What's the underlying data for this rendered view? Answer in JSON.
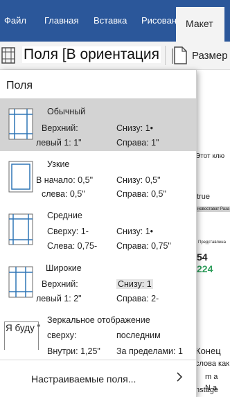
{
  "ribbon": {
    "tabs": [
      {
        "label": "Файл"
      },
      {
        "label": "Главная"
      },
      {
        "label": "Вставка"
      },
      {
        "label": "Рисование"
      },
      {
        "label": "Макет",
        "active": true
      }
    ]
  },
  "toolbar": {
    "margins_title": "Поля [В ориентация",
    "size_label": "Размер"
  },
  "margins_menu": {
    "header": "Поля",
    "options": [
      {
        "title": "Обычный",
        "l1": "Верхний:",
        "r1": "Снизу: 1•",
        "l2": "левый 1: 1\"",
        "r2": "Справа: 1\"",
        "selected": true
      },
      {
        "title": "Узкие",
        "l1": "В начало: 0,5\"",
        "r1": "Снизу: 0,5\"",
        "l2": "слева: 0,5\"",
        "r2": "Справа: 0,5\""
      },
      {
        "title": "Средние",
        "l1": "Сверху: 1-",
        "r1": "Снизу: 1•",
        "l2": "Слева: 0,75-",
        "r2": "Справа: 0,75\""
      },
      {
        "title": "Широкие",
        "l1": "Верхний:",
        "r1": "Снизу: 1",
        "l2": "левый 1: 2\"",
        "r2": "Справа: 2-"
      },
      {
        "title": "Зеркальное отображение",
        "icon_text": "Я буду \"",
        "l1": "сверху:",
        "r1": "последним",
        "l2": "Внутри: 1,25\"",
        "r2": "За пределами: 1"
      }
    ],
    "custom_label": "Настраиваемые поля...",
    "colors": {
      "selected_bg": "#d3d3d3",
      "ribbon": "#2b579a",
      "icon_blue": "#2e75b6"
    }
  },
  "document": {
    "lines": [
      "Этот клю",
      "true",
      "новостават Раза",
      "Представлена",
      "54",
      "224",
      "Конец",
      "слова как",
      "m а",
      "N a",
      "nstage"
    ],
    "accent_number_color": "#2e9d5b"
  }
}
